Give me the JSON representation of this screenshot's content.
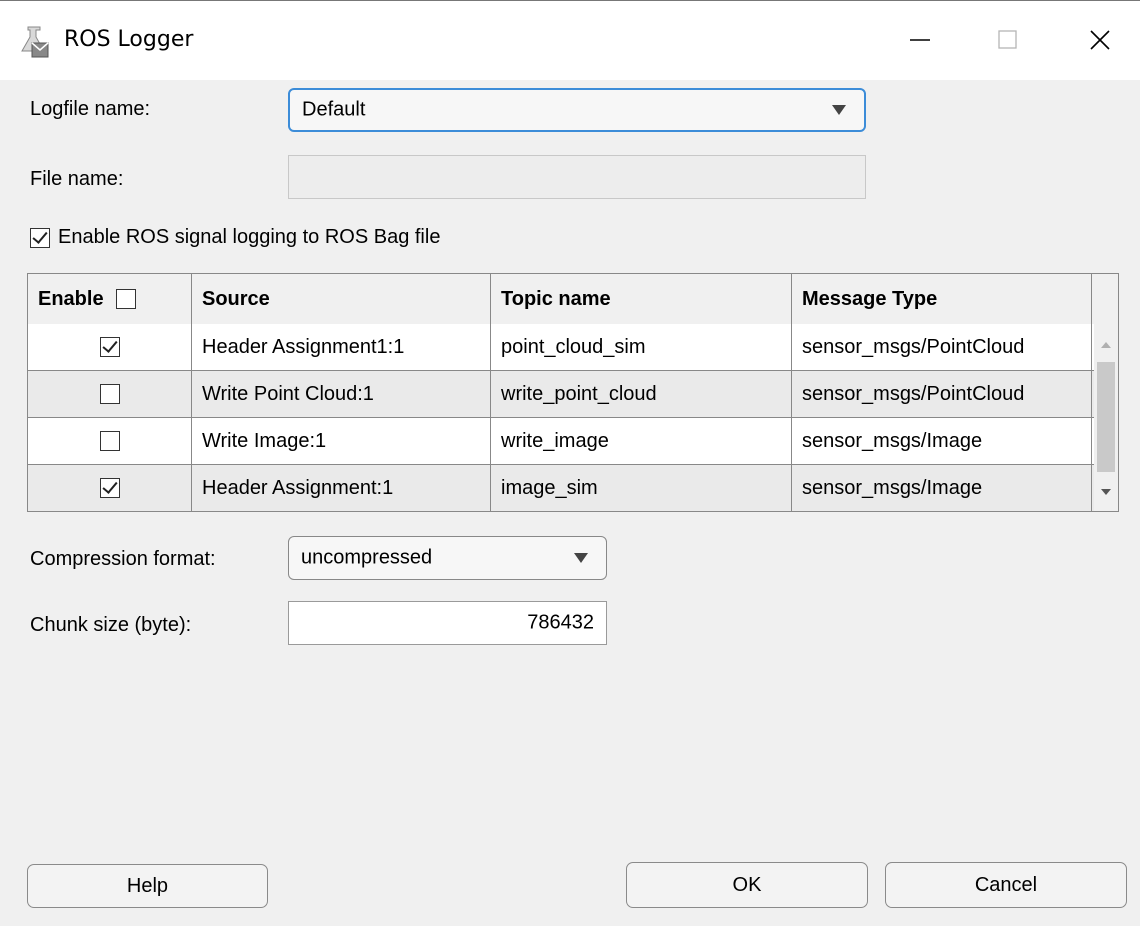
{
  "window": {
    "title": "ROS Logger",
    "icon": "ros-logger-icon"
  },
  "logfile": {
    "label": "Logfile name:",
    "value": "Default"
  },
  "filename": {
    "label": "File name:",
    "value": ""
  },
  "enable_logging": {
    "label": "Enable ROS signal logging to ROS Bag file",
    "checked": true
  },
  "table": {
    "headers": [
      "Enable",
      "Source",
      "Topic name",
      "Message Type"
    ],
    "header_checkbox_checked": false,
    "rows": [
      {
        "enabled": true,
        "source": "Header Assignment1:1",
        "topic": "point_cloud_sim",
        "type": "sensor_msgs/PointCloud"
      },
      {
        "enabled": false,
        "source": "Write Point Cloud:1",
        "topic": "write_point_cloud",
        "type": "sensor_msgs/PointCloud"
      },
      {
        "enabled": false,
        "source": "Write Image:1",
        "topic": "write_image",
        "type": "sensor_msgs/Image"
      },
      {
        "enabled": true,
        "source": "Header Assignment:1",
        "topic": "image_sim",
        "type": "sensor_msgs/Image"
      }
    ]
  },
  "compression": {
    "label": "Compression format:",
    "value": "uncompressed"
  },
  "chunk": {
    "label": "Chunk size (byte):",
    "value": "786432"
  },
  "buttons": {
    "help": "Help",
    "ok": "OK",
    "cancel": "Cancel"
  },
  "colors": {
    "focus_border": "#3c8cd8",
    "dialog_bg": "#f0f0f0",
    "alt_row": "#eaeaea"
  }
}
